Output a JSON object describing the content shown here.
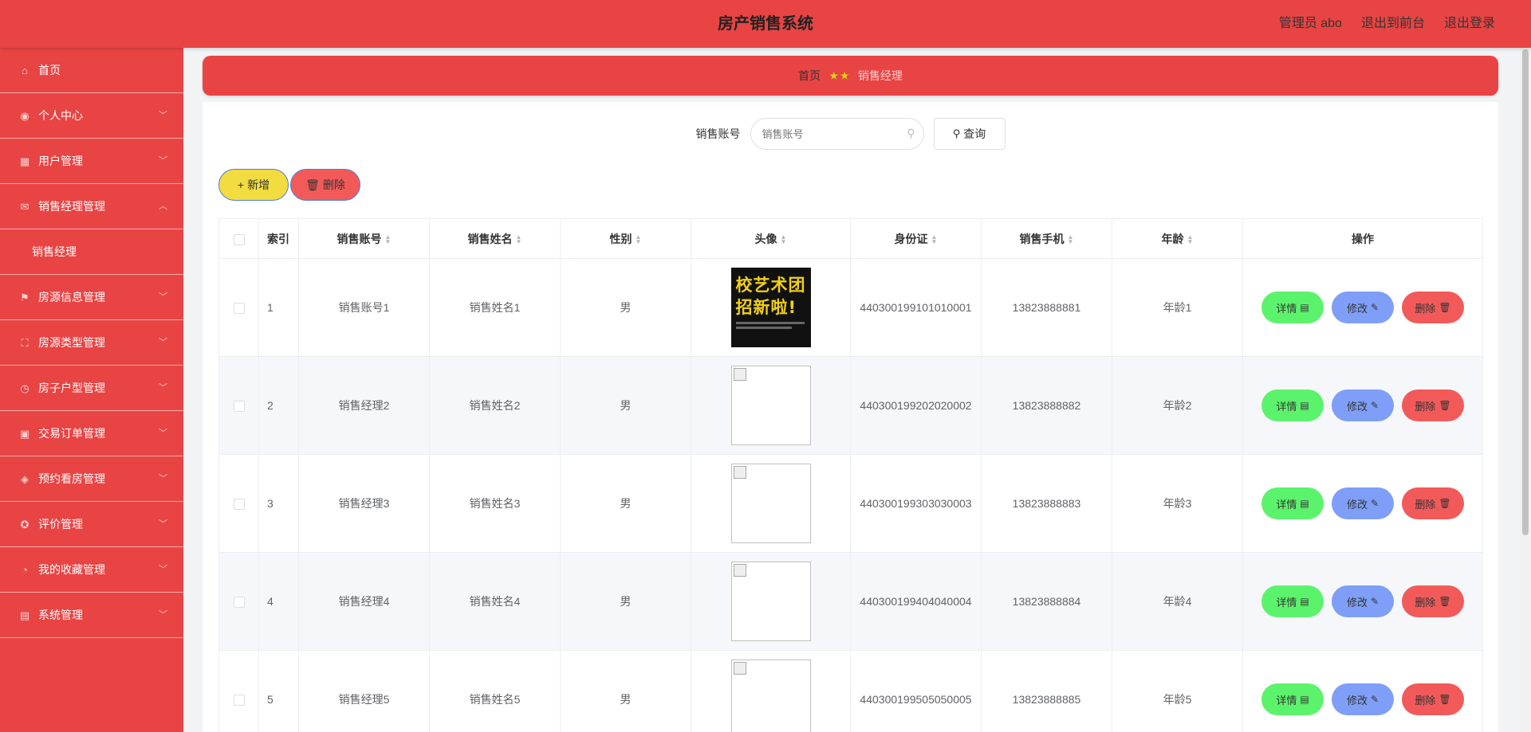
{
  "header": {
    "title": "房产销售系统",
    "user_label": "管理员 abo",
    "to_front_label": "退出到前台",
    "logout_label": "退出登录"
  },
  "sidebar": {
    "items": [
      {
        "label": "首页",
        "icon": "home-icon",
        "expandable": false
      },
      {
        "label": "个人中心",
        "icon": "user-icon",
        "expandable": true
      },
      {
        "label": "用户管理",
        "icon": "grid-icon",
        "expandable": true
      },
      {
        "label": "销售经理管理",
        "icon": "mail-icon",
        "expandable": true,
        "expanded": true,
        "children": [
          "销售经理"
        ]
      },
      {
        "label": "房源信息管理",
        "icon": "flag-icon",
        "expandable": true
      },
      {
        "label": "房源类型管理",
        "icon": "fullscreen-icon",
        "expandable": true
      },
      {
        "label": "房子户型管理",
        "icon": "clock-icon",
        "expandable": true
      },
      {
        "label": "交易订单管理",
        "icon": "briefcase-icon",
        "expandable": true
      },
      {
        "label": "预约看房管理",
        "icon": "location-icon",
        "expandable": true
      },
      {
        "label": "评价管理",
        "icon": "help-icon",
        "expandable": true
      },
      {
        "label": "我的收藏管理",
        "icon": "time-icon",
        "expandable": true
      },
      {
        "label": "系统管理",
        "icon": "chat-icon",
        "expandable": true
      }
    ]
  },
  "breadcrumb": {
    "home": "首页",
    "current": "销售经理"
  },
  "search": {
    "label": "销售账号",
    "placeholder": "销售账号",
    "button_label": "查询"
  },
  "actions": {
    "add_label": "新增",
    "delete_label": "删除"
  },
  "table": {
    "columns": [
      "索引",
      "销售账号",
      "销售姓名",
      "性别",
      "头像",
      "身份证",
      "销售手机",
      "年龄",
      "操作"
    ],
    "rows": [
      {
        "index": "1",
        "account": "销售账号1",
        "name": "销售姓名1",
        "gender": "男",
        "avatar": "poster",
        "poster_text": [
          "校艺术团",
          "招新啦!"
        ],
        "id_card": "440300199101010001",
        "phone": "13823888881",
        "age": "年龄1"
      },
      {
        "index": "2",
        "account": "销售经理2",
        "name": "销售姓名2",
        "gender": "男",
        "avatar": "broken",
        "id_card": "440300199202020002",
        "phone": "13823888882",
        "age": "年龄2"
      },
      {
        "index": "3",
        "account": "销售经理3",
        "name": "销售姓名3",
        "gender": "男",
        "avatar": "broken",
        "id_card": "440300199303030003",
        "phone": "13823888883",
        "age": "年龄3"
      },
      {
        "index": "4",
        "account": "销售经理4",
        "name": "销售姓名4",
        "gender": "男",
        "avatar": "broken",
        "id_card": "440300199404040004",
        "phone": "13823888884",
        "age": "年龄4"
      },
      {
        "index": "5",
        "account": "销售经理5",
        "name": "销售姓名5",
        "gender": "男",
        "avatar": "broken",
        "id_card": "440300199505050005",
        "phone": "13823888885",
        "age": "年龄5"
      }
    ],
    "row_actions": {
      "detail": "详情",
      "edit": "修改",
      "remove": "删除"
    }
  },
  "colors": {
    "primary_red": "#e84444",
    "add_yellow": "#f2dc3f",
    "detail_green": "#5cf36c",
    "edit_blue": "#7f9ef7",
    "delete_red": "#f25a5a"
  }
}
